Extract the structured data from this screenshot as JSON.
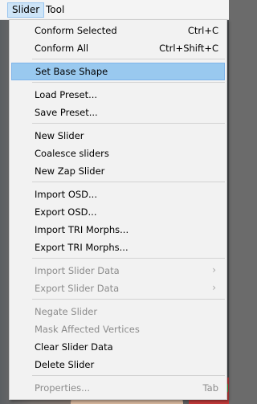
{
  "menubar": {
    "items": [
      {
        "label": "Slider",
        "active": true
      },
      {
        "label": "Tool",
        "active": false
      }
    ]
  },
  "menu": {
    "items": [
      {
        "label": "Conform Selected",
        "shortcut": "Ctrl+C",
        "enabled": true
      },
      {
        "label": "Conform All",
        "shortcut": "Ctrl+Shift+C",
        "enabled": true
      },
      {
        "label": "Set Base Shape",
        "enabled": true,
        "highlighted": true
      },
      {
        "label": "Load Preset...",
        "enabled": true
      },
      {
        "label": "Save Preset...",
        "enabled": true
      },
      {
        "label": "New Slider",
        "enabled": true
      },
      {
        "label": "Coalesce sliders",
        "enabled": true
      },
      {
        "label": "New Zap Slider",
        "enabled": true
      },
      {
        "label": "Import OSD...",
        "enabled": true
      },
      {
        "label": "Export OSD...",
        "enabled": true
      },
      {
        "label": "Import TRI Morphs...",
        "enabled": true
      },
      {
        "label": "Export TRI Morphs...",
        "enabled": true
      },
      {
        "label": "Import Slider Data",
        "enabled": false,
        "submenu": true
      },
      {
        "label": "Export Slider Data",
        "enabled": false,
        "submenu": true
      },
      {
        "label": "Negate Slider",
        "enabled": false
      },
      {
        "label": "Mask Affected Vertices",
        "enabled": false
      },
      {
        "label": "Clear Slider Data",
        "enabled": true
      },
      {
        "label": "Delete Slider",
        "enabled": true
      },
      {
        "label": "Properties...",
        "shortcut": "Tab",
        "enabled": false
      }
    ],
    "submenu_arrow": "›"
  }
}
